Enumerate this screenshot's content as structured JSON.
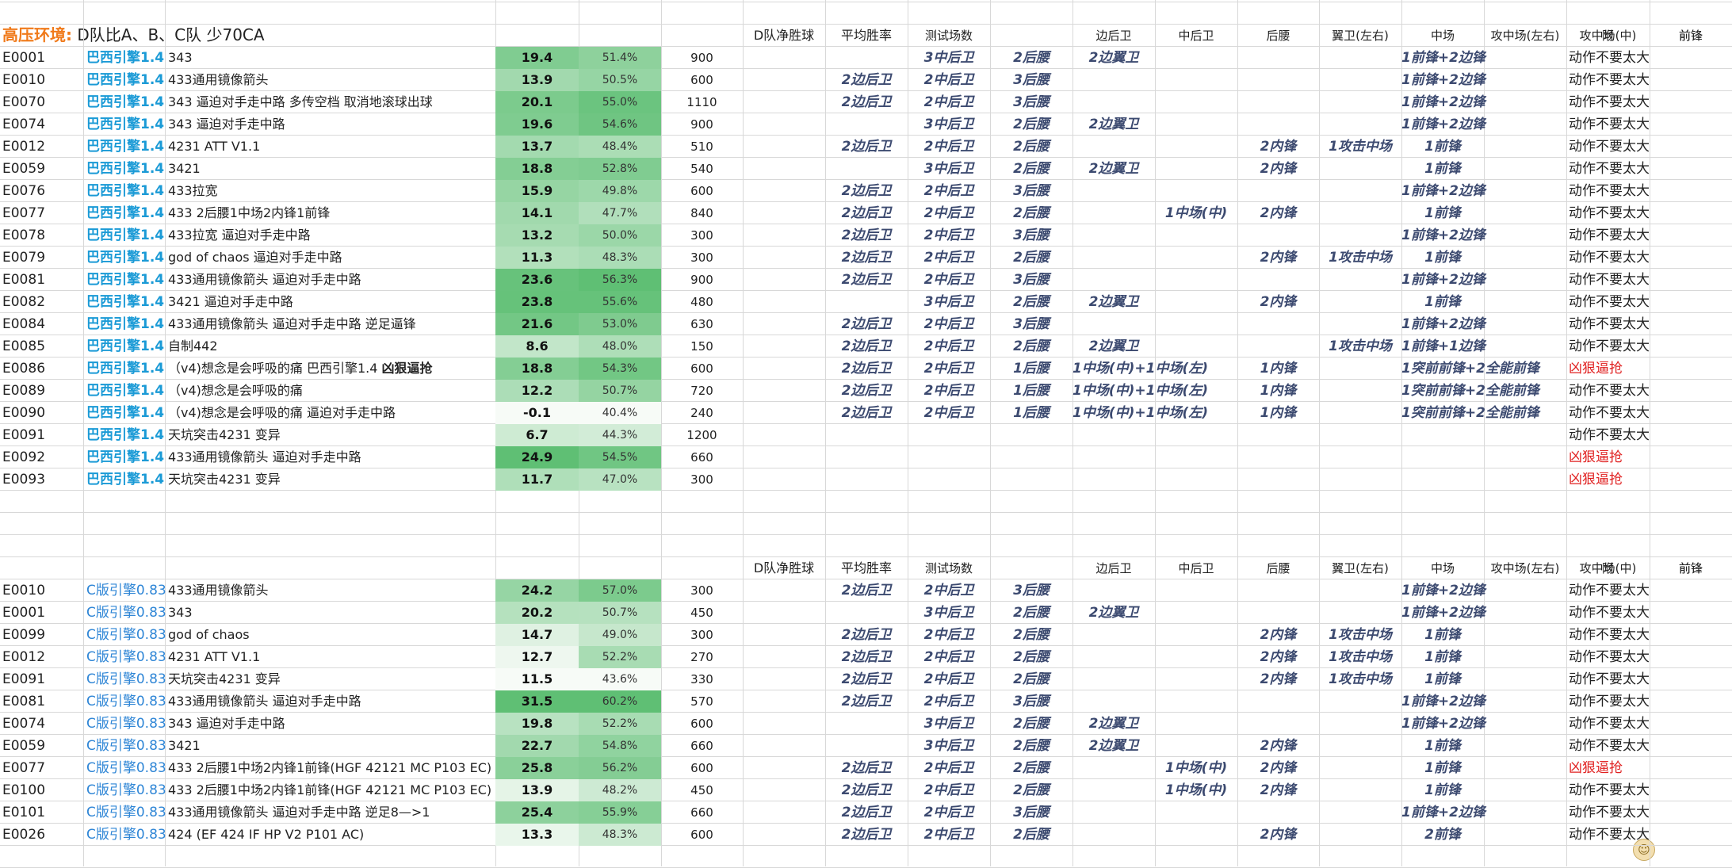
{
  "title": {
    "label": "高压环境:",
    "text": "D队比A、B、C队 少70CA"
  },
  "header": [
    "D队净胜球",
    "平均胜率",
    "测试场数",
    "边后卫",
    "中后卫",
    "后腰",
    "翼卫(左右)",
    "中场",
    "攻中场(左右)",
    "攻中场(中)",
    "前锋",
    "附"
  ],
  "colors": {
    "engineA": "#1a9ad6",
    "engineB": "#2f86d6",
    "title": "#f07a1a",
    "red": "#e02020",
    "position": "#3c4a70",
    "heat_low": "#f7fbf7",
    "heat_high": "#5fbf74"
  },
  "table1": [
    {
      "code": "E0001",
      "engine": "巴西引擎1.4",
      "tactic": "343",
      "net": "19.4",
      "win": "51.4%",
      "games": "900",
      "fb": "",
      "cb": "3中后卫",
      "dm": "2后腰",
      "wb": "2边翼卫",
      "mid": "",
      "am_lr": "",
      "am_c": "",
      "fw": "1前锋+2边锋",
      "note": "动作不要太大",
      "note_red": false
    },
    {
      "code": "E0010",
      "engine": "巴西引擎1.4",
      "tactic": "433通用镜像箭头",
      "net": "13.9",
      "win": "50.5%",
      "games": "600",
      "fb": "2边后卫",
      "cb": "2中后卫",
      "dm": "3后腰",
      "wb": "",
      "mid": "",
      "am_lr": "",
      "am_c": "",
      "fw": "1前锋+2边锋",
      "note": "动作不要太大",
      "note_red": false
    },
    {
      "code": "E0070",
      "engine": "巴西引擎1.4",
      "tactic": "343 逼迫对手走中路 多传空档 取消地滚球出球",
      "net": "20.1",
      "win": "55.0%",
      "games": "1110",
      "fb": "2边后卫",
      "cb": "2中后卫",
      "dm": "3后腰",
      "wb": "",
      "mid": "",
      "am_lr": "",
      "am_c": "",
      "fw": "1前锋+2边锋",
      "note": "动作不要太大",
      "note_red": false
    },
    {
      "code": "E0074",
      "engine": "巴西引擎1.4",
      "tactic": "343 逼迫对手走中路",
      "net": "19.6",
      "win": "54.6%",
      "games": "900",
      "fb": "",
      "cb": "3中后卫",
      "dm": "2后腰",
      "wb": "2边翼卫",
      "mid": "",
      "am_lr": "",
      "am_c": "",
      "fw": "1前锋+2边锋",
      "note": "动作不要太大",
      "note_red": false
    },
    {
      "code": "E0012",
      "engine": "巴西引擎1.4",
      "tactic": "4231 ATT V1.1",
      "net": "13.7",
      "win": "48.4%",
      "games": "510",
      "fb": "2边后卫",
      "cb": "2中后卫",
      "dm": "2后腰",
      "wb": "",
      "mid": "",
      "am_lr": "2内锋",
      "am_c": "1攻击中场",
      "fw": "1前锋",
      "note": "动作不要太大",
      "note_red": false
    },
    {
      "code": "E0059",
      "engine": "巴西引擎1.4",
      "tactic": "3421",
      "net": "18.8",
      "win": "52.8%",
      "games": "540",
      "fb": "",
      "cb": "3中后卫",
      "dm": "2后腰",
      "wb": "2边翼卫",
      "mid": "",
      "am_lr": "2内锋",
      "am_c": "",
      "fw": "1前锋",
      "note": "动作不要太大",
      "note_red": false
    },
    {
      "code": "E0076",
      "engine": "巴西引擎1.4",
      "tactic": "433拉宽",
      "net": "15.9",
      "win": "49.8%",
      "games": "600",
      "fb": "2边后卫",
      "cb": "2中后卫",
      "dm": "3后腰",
      "wb": "",
      "mid": "",
      "am_lr": "",
      "am_c": "",
      "fw": "1前锋+2边锋",
      "note": "动作不要太大",
      "note_red": false
    },
    {
      "code": "E0077",
      "engine": "巴西引擎1.4",
      "tactic": "433 2后腰1中场2内锋1前锋",
      "net": "14.1",
      "win": "47.7%",
      "games": "840",
      "fb": "2边后卫",
      "cb": "2中后卫",
      "dm": "2后腰",
      "wb": "",
      "mid": "1中场(中)",
      "am_lr": "2内锋",
      "am_c": "",
      "fw": "1前锋",
      "note": "动作不要太大",
      "note_red": false
    },
    {
      "code": "E0078",
      "engine": "巴西引擎1.4",
      "tactic": "433拉宽 逼迫对手走中路",
      "net": "13.2",
      "win": "50.0%",
      "games": "300",
      "fb": "2边后卫",
      "cb": "2中后卫",
      "dm": "3后腰",
      "wb": "",
      "mid": "",
      "am_lr": "",
      "am_c": "",
      "fw": "1前锋+2边锋",
      "note": "动作不要太大",
      "note_red": false
    },
    {
      "code": "E0079",
      "engine": "巴西引擎1.4",
      "tactic": "god of chaos 逼迫对手走中路",
      "net": "11.3",
      "win": "48.3%",
      "games": "300",
      "fb": "2边后卫",
      "cb": "2中后卫",
      "dm": "2后腰",
      "wb": "",
      "mid": "",
      "am_lr": "2内锋",
      "am_c": "1攻击中场",
      "fw": "1前锋",
      "note": "动作不要太大",
      "note_red": false
    },
    {
      "code": "E0081",
      "engine": "巴西引擎1.4",
      "tactic": "433通用镜像箭头 逼迫对手走中路",
      "net": "23.6",
      "win": "56.3%",
      "games": "900",
      "fb": "2边后卫",
      "cb": "2中后卫",
      "dm": "3后腰",
      "wb": "",
      "mid": "",
      "am_lr": "",
      "am_c": "",
      "fw": "1前锋+2边锋",
      "note": "动作不要太大",
      "note_red": false
    },
    {
      "code": "E0082",
      "engine": "巴西引擎1.4",
      "tactic": "3421 逼迫对手走中路",
      "net": "23.8",
      "win": "55.6%",
      "games": "480",
      "fb": "",
      "cb": "3中后卫",
      "dm": "2后腰",
      "wb": "2边翼卫",
      "mid": "",
      "am_lr": "2内锋",
      "am_c": "",
      "fw": "1前锋",
      "note": "动作不要太大",
      "note_red": false
    },
    {
      "code": "E0084",
      "engine": "巴西引擎1.4",
      "tactic": "433通用镜像箭头 逼迫对手走中路 逆足逼锋",
      "net": "21.6",
      "win": "53.0%",
      "games": "630",
      "fb": "2边后卫",
      "cb": "2中后卫",
      "dm": "3后腰",
      "wb": "",
      "mid": "",
      "am_lr": "",
      "am_c": "",
      "fw": "1前锋+2边锋",
      "note": "动作不要太大",
      "note_red": false
    },
    {
      "code": "E0085",
      "engine": "巴西引擎1.4",
      "tactic": "自制442",
      "net": "8.6",
      "win": "48.0%",
      "games": "150",
      "fb": "2边后卫",
      "cb": "2中后卫",
      "dm": "2后腰",
      "wb": "2边翼卫",
      "mid": "",
      "am_lr": "",
      "am_c": "1攻击中场",
      "fw": "1前锋+1边锋",
      "note": "动作不要太大",
      "note_red": false
    },
    {
      "code": "E0086",
      "engine": "巴西引擎1.4",
      "tactic": "（v4)想念是会呼吸的痛 巴西引擎1.4 ",
      "tactic_bold": "凶狠逼抢",
      "net": "18.8",
      "win": "54.3%",
      "games": "600",
      "fb": "2边后卫",
      "cb": "2中后卫",
      "dm": "1后腰",
      "wb": "1中场(中)+1中场(左)",
      "mid": "",
      "am_lr": "1内锋",
      "am_c": "",
      "fw": "1突前前锋+2全能前锋",
      "note": "凶狠逼抢",
      "note_red": true
    },
    {
      "code": "E0089",
      "engine": "巴西引擎1.4",
      "tactic": "（v4)想念是会呼吸的痛",
      "net": "12.2",
      "win": "50.7%",
      "games": "720",
      "fb": "2边后卫",
      "cb": "2中后卫",
      "dm": "1后腰",
      "wb": "1中场(中)+1中场(左)",
      "mid": "",
      "am_lr": "1内锋",
      "am_c": "",
      "fw": "1突前前锋+2全能前锋",
      "note": "动作不要太大",
      "note_red": false
    },
    {
      "code": "E0090",
      "engine": "巴西引擎1.4",
      "tactic": "（v4)想念是会呼吸的痛  逼迫对手走中路",
      "net": "-0.1",
      "win": "40.4%",
      "games": "240",
      "fb": "2边后卫",
      "cb": "2中后卫",
      "dm": "1后腰",
      "wb": "1中场(中)+1中场(左)",
      "mid": "",
      "am_lr": "1内锋",
      "am_c": "",
      "fw": "1突前前锋+2全能前锋",
      "note": "动作不要太大",
      "note_red": false
    },
    {
      "code": "E0091",
      "engine": "巴西引擎1.4",
      "tactic": "天坑突击4231 变异",
      "net": "6.7",
      "win": "44.3%",
      "games": "1200",
      "fb": "",
      "cb": "",
      "dm": "",
      "wb": "",
      "mid": "",
      "am_lr": "",
      "am_c": "",
      "fw": "",
      "note": "动作不要太大",
      "note_red": false
    },
    {
      "code": "E0092",
      "engine": "巴西引擎1.4",
      "tactic": "433通用镜像箭头 逼迫对手走中路",
      "net": "24.9",
      "win": "54.5%",
      "games": "660",
      "fb": "",
      "cb": "",
      "dm": "",
      "wb": "",
      "mid": "",
      "am_lr": "",
      "am_c": "",
      "fw": "",
      "note": "凶狠逼抢",
      "note_red": true
    },
    {
      "code": "E0093",
      "engine": "巴西引擎1.4",
      "tactic": "天坑突击4231 变异",
      "net": "11.7",
      "win": "47.0%",
      "games": "300",
      "fb": "",
      "cb": "",
      "dm": "",
      "wb": "",
      "mid": "",
      "am_lr": "",
      "am_c": "",
      "fw": "",
      "note": "凶狠逼抢",
      "note_red": true
    }
  ],
  "table2": [
    {
      "code": "E0010",
      "engine": "C版引擎0.83",
      "tactic": "433通用镜像箭头",
      "net": "24.2",
      "win": "57.0%",
      "games": "300",
      "fb": "2边后卫",
      "cb": "2中后卫",
      "dm": "3后腰",
      "wb": "",
      "mid": "",
      "am_lr": "",
      "am_c": "",
      "fw": "1前锋+2边锋",
      "note": "动作不要太大",
      "note_red": false
    },
    {
      "code": "E0001",
      "engine": "C版引擎0.83",
      "tactic": "343",
      "net": "20.2",
      "win": "50.7%",
      "games": "450",
      "fb": "",
      "cb": "3中后卫",
      "dm": "2后腰",
      "wb": "2边翼卫",
      "mid": "",
      "am_lr": "",
      "am_c": "",
      "fw": "1前锋+2边锋",
      "note": "动作不要太大",
      "note_red": false
    },
    {
      "code": "E0099",
      "engine": "C版引擎0.83",
      "tactic": "god of chaos",
      "net": "14.7",
      "win": "49.0%",
      "games": "300",
      "fb": "2边后卫",
      "cb": "2中后卫",
      "dm": "2后腰",
      "wb": "",
      "mid": "",
      "am_lr": "2内锋",
      "am_c": "1攻击中场",
      "fw": "1前锋",
      "note": "动作不要太大",
      "note_red": false
    },
    {
      "code": "E0012",
      "engine": "C版引擎0.83",
      "tactic": "4231 ATT V1.1",
      "net": "12.7",
      "win": "52.2%",
      "games": "270",
      "fb": "2边后卫",
      "cb": "2中后卫",
      "dm": "2后腰",
      "wb": "",
      "mid": "",
      "am_lr": "2内锋",
      "am_c": "1攻击中场",
      "fw": "1前锋",
      "note": "动作不要太大",
      "note_red": false
    },
    {
      "code": "E0091",
      "engine": "C版引擎0.83",
      "tactic": "天坑突击4231 变异",
      "net": "11.5",
      "win": "43.6%",
      "games": "330",
      "fb": "2边后卫",
      "cb": "2中后卫",
      "dm": "2后腰",
      "wb": "",
      "mid": "",
      "am_lr": "2内锋",
      "am_c": "1攻击中场",
      "fw": "1前锋",
      "note": "动作不要太大",
      "note_red": false
    },
    {
      "code": "E0081",
      "engine": "C版引擎0.83",
      "tactic": "433通用镜像箭头 逼迫对手走中路",
      "net": "31.5",
      "win": "60.2%",
      "games": "570",
      "fb": "2边后卫",
      "cb": "2中后卫",
      "dm": "3后腰",
      "wb": "",
      "mid": "",
      "am_lr": "",
      "am_c": "",
      "fw": "1前锋+2边锋",
      "note": "动作不要太大",
      "note_red": false
    },
    {
      "code": "E0074",
      "engine": "C版引擎0.83",
      "tactic": "343 逼迫对手走中路",
      "net": "19.8",
      "win": "52.2%",
      "games": "600",
      "fb": "",
      "cb": "3中后卫",
      "dm": "2后腰",
      "wb": "2边翼卫",
      "mid": "",
      "am_lr": "",
      "am_c": "",
      "fw": "1前锋+2边锋",
      "note": "动作不要太大",
      "note_red": false
    },
    {
      "code": "E0059",
      "engine": "C版引擎0.83",
      "tactic": "3421",
      "net": "22.7",
      "win": "54.8%",
      "games": "660",
      "fb": "",
      "cb": "3中后卫",
      "dm": "2后腰",
      "wb": "2边翼卫",
      "mid": "",
      "am_lr": "2内锋",
      "am_c": "",
      "fw": "1前锋",
      "note": "动作不要太大",
      "note_red": false
    },
    {
      "code": "E0077",
      "engine": "C版引擎0.83",
      "tactic": "433 2后腰1中场2内锋1前锋(HGF 42121 MC P103  EC)",
      "net": "25.8",
      "win": "56.2%",
      "games": "600",
      "fb": "2边后卫",
      "cb": "2中后卫",
      "dm": "2后腰",
      "wb": "",
      "mid": "1中场(中)",
      "am_lr": "2内锋",
      "am_c": "",
      "fw": "1前锋",
      "note": "凶狠逼抢",
      "note_red": true
    },
    {
      "code": "E0100",
      "engine": "C版引擎0.83",
      "tactic": "433 2后腰1中场2内锋1前锋(HGF 42121 MC P103  EC)",
      "net": "13.9",
      "win": "48.2%",
      "games": "450",
      "fb": "2边后卫",
      "cb": "2中后卫",
      "dm": "2后腰",
      "wb": "",
      "mid": "1中场(中)",
      "am_lr": "2内锋",
      "am_c": "",
      "fw": "1前锋",
      "note": "动作不要太大",
      "note_red": false
    },
    {
      "code": "E0101",
      "engine": "C版引擎0.83",
      "tactic": "433通用镜像箭头 逼迫对手走中路 逆足8—>1",
      "net": "25.4",
      "win": "55.9%",
      "games": "660",
      "fb": "2边后卫",
      "cb": "2中后卫",
      "dm": "3后腰",
      "wb": "",
      "mid": "",
      "am_lr": "",
      "am_c": "",
      "fw": "1前锋+2边锋",
      "note": "动作不要太大",
      "note_red": false
    },
    {
      "code": "E0026",
      "engine": "C版引擎0.83",
      "tactic": "424 (EF 424 IF HP V2 P101 AC)",
      "net": "13.3",
      "win": "48.3%",
      "games": "600",
      "fb": "2边后卫",
      "cb": "2中后卫",
      "dm": "2后腰",
      "wb": "",
      "mid": "",
      "am_lr": "2内锋",
      "am_c": "",
      "fw": "2前锋",
      "note": "动作不要太大",
      "note_red": false
    }
  ]
}
